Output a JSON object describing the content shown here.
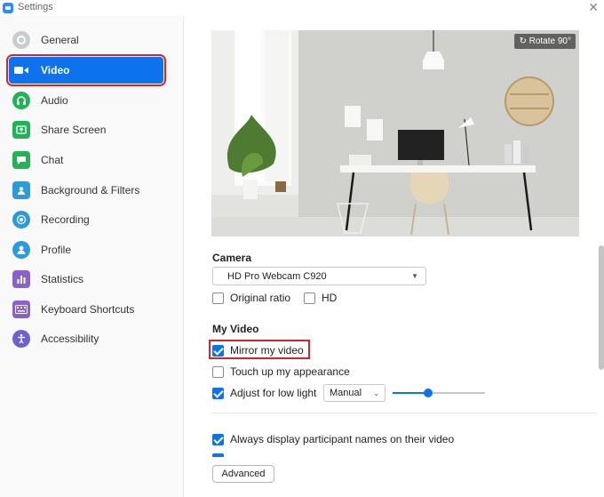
{
  "window": {
    "title": "Settings",
    "close_label": "✕"
  },
  "sidebar": {
    "items": [
      {
        "label": "General",
        "icon": "gear-icon",
        "color": "#c9ccd1"
      },
      {
        "label": "Video",
        "icon": "video-camera-icon",
        "color": "#0e72ed",
        "active": true
      },
      {
        "label": "Audio",
        "icon": "headphones-icon",
        "color": "#23b25a"
      },
      {
        "label": "Share Screen",
        "icon": "share-screen-icon",
        "color": "#23b25a"
      },
      {
        "label": "Chat",
        "icon": "chat-bubble-icon",
        "color": "#23b25a"
      },
      {
        "label": "Background & Filters",
        "icon": "background-icon",
        "color": "#2d9bd8"
      },
      {
        "label": "Recording",
        "icon": "record-icon",
        "color": "#2d9bd8"
      },
      {
        "label": "Profile",
        "icon": "profile-icon",
        "color": "#2d9bd8"
      },
      {
        "label": "Statistics",
        "icon": "statistics-icon",
        "color": "#8a62c9"
      },
      {
        "label": "Keyboard Shortcuts",
        "icon": "keyboard-icon",
        "color": "#8a62c9"
      },
      {
        "label": "Accessibility",
        "icon": "accessibility-icon",
        "color": "#6b61d1"
      }
    ]
  },
  "preview": {
    "rotate_label": "Rotate 90°"
  },
  "camera": {
    "heading": "Camera",
    "selected": "HD Pro Webcam C920"
  },
  "camera_options": {
    "original_ratio": {
      "label": "Original ratio",
      "checked": false
    },
    "hd": {
      "label": "HD",
      "checked": false
    }
  },
  "my_video": {
    "heading": "My Video",
    "mirror": {
      "label": "Mirror my video",
      "checked": true
    },
    "touch_up": {
      "label": "Touch up my appearance",
      "checked": false
    },
    "low_light": {
      "label": "Adjust for low light",
      "checked": true,
      "mode": "Manual",
      "level": 0.38
    }
  },
  "always_names": {
    "label": "Always display participant names on their video",
    "checked": true
  },
  "advanced_label": "Advanced"
}
